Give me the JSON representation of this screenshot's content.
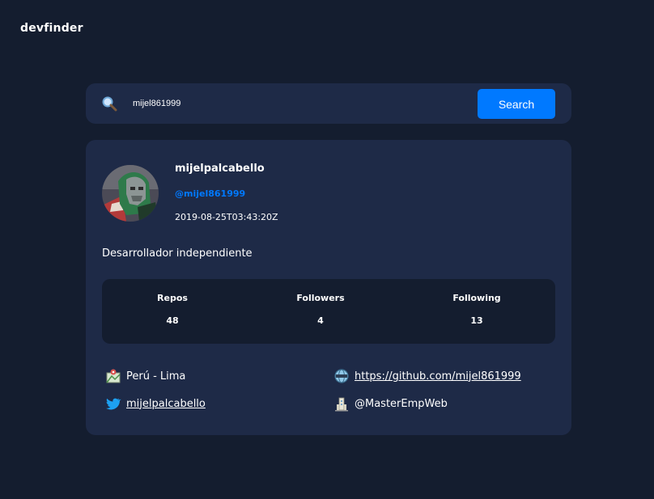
{
  "app": {
    "title": "devfinder"
  },
  "search": {
    "value": "mijel861999",
    "button_label": "Search"
  },
  "profile": {
    "name": "mijelpalcabello",
    "login": "@mijel861999",
    "created_at": "2019-08-25T03:43:20Z",
    "bio": "Desarrollador independiente"
  },
  "stats": [
    {
      "label": "Repos",
      "value": "48"
    },
    {
      "label": "Followers",
      "value": "4"
    },
    {
      "label": "Following",
      "value": "13"
    }
  ],
  "links": {
    "location": "Perú - Lima",
    "blog": "https://github.com/mijel861999",
    "twitter": "mijelpalcabello",
    "company": "@MasterEmpWeb"
  },
  "colors": {
    "background": "#141d2f",
    "card": "#1e2a47",
    "accent": "#0079ff"
  },
  "icons": {
    "search": "magnifying-glass-icon",
    "location": "map-icon",
    "blog": "globe-icon",
    "twitter": "twitter-bird-icon",
    "company": "building-icon"
  }
}
